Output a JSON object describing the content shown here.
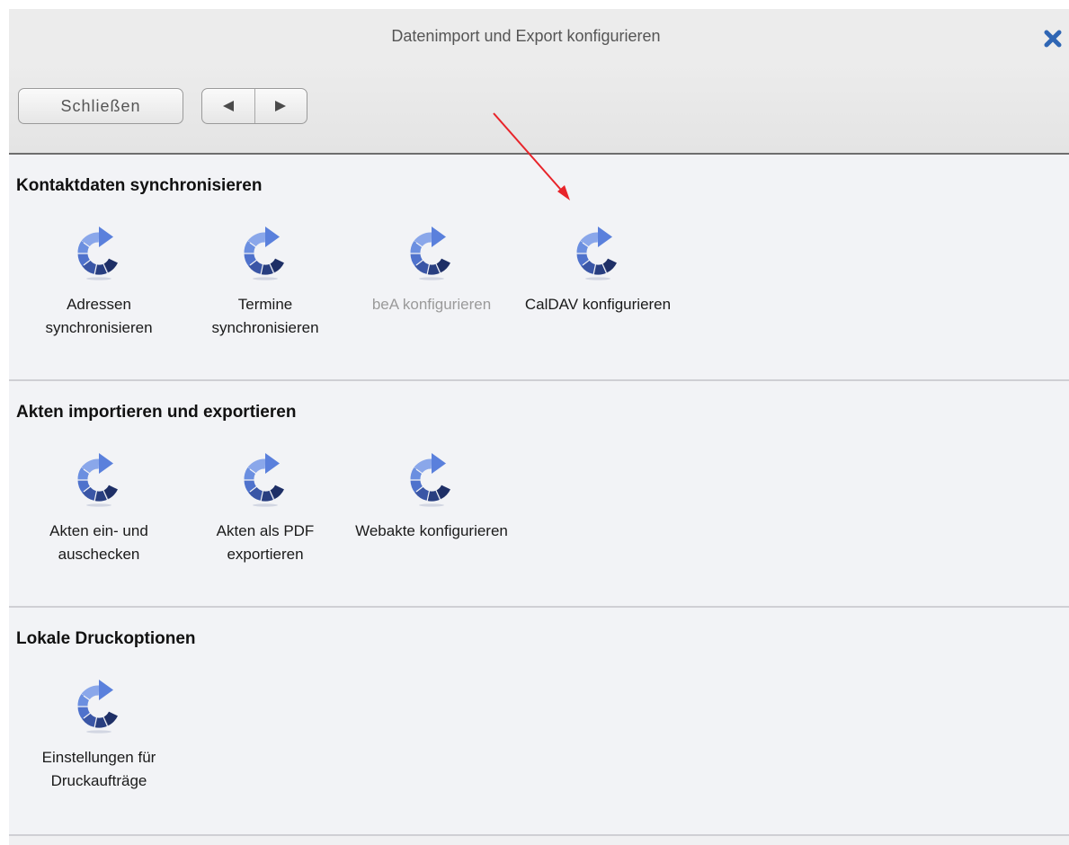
{
  "dialog": {
    "title": "Datenimport und Export konfigurieren"
  },
  "toolbar": {
    "close_label": "Schließen"
  },
  "sections": [
    {
      "title": "Kontaktdaten synchronisieren",
      "items": [
        {
          "label": "Adressen synchronisieren",
          "enabled": true
        },
        {
          "label": "Termine synchronisieren",
          "enabled": true
        },
        {
          "label": "beA konfigurieren",
          "enabled": false
        },
        {
          "label": "CalDAV konfigurieren",
          "enabled": true
        }
      ]
    },
    {
      "title": "Akten importieren und exportieren",
      "items": [
        {
          "label": "Akten ein- und auschecken",
          "enabled": true
        },
        {
          "label": "Akten als PDF exportieren",
          "enabled": true
        },
        {
          "label": "Webakte konfigurieren",
          "enabled": true
        }
      ]
    },
    {
      "title": "Lokale Druckoptionen",
      "items": [
        {
          "label": "Einstellungen für Druckaufträge",
          "enabled": true
        }
      ]
    }
  ],
  "colors": {
    "annotation_arrow": "#e8242a",
    "icon_light": "#6b8fe0",
    "icon_dark": "#1e2f66",
    "close_x": "#2f66b4"
  }
}
